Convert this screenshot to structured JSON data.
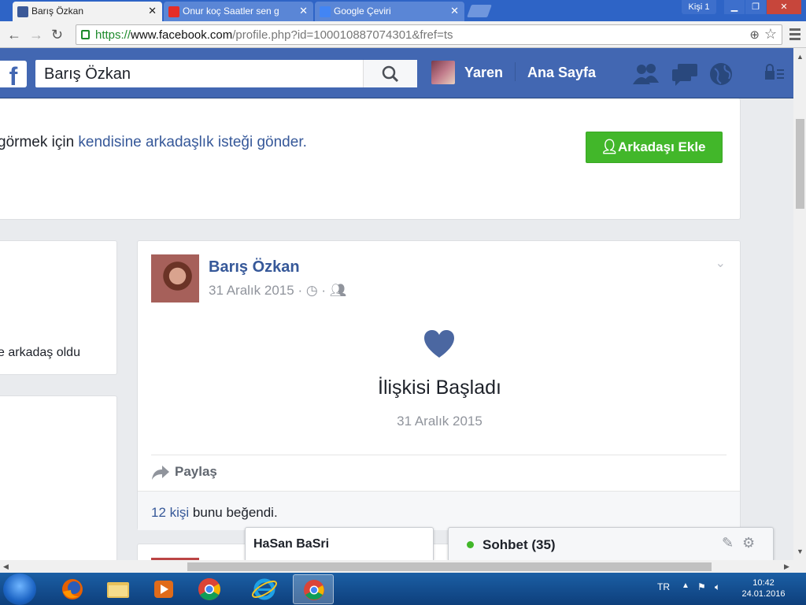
{
  "browser": {
    "tabs": [
      {
        "title": "Barış Özkan",
        "favicon": "facebook-favicon"
      },
      {
        "title": "Onur koç Saatler sen g",
        "favicon": "youtube-favicon"
      },
      {
        "title": "Google Çeviri",
        "favicon": "google-translate-favicon"
      }
    ],
    "profile_label": "Kişi 1",
    "url_scheme": "https://",
    "url_host": "www.facebook.com",
    "url_path": "/profile.php?id=100010887074301&fref=ts"
  },
  "fb_header": {
    "search_value": "Barış Özkan",
    "user_name": "Yaren",
    "home_label": "Ana Sayfa",
    "icons": [
      "friend-requests-icon",
      "messages-icon",
      "notifications-globe-icon",
      "privacy-lock-icon",
      "account-menu-icon"
    ]
  },
  "friend_banner": {
    "text_prefix": "görmek için ",
    "link_text": "kendisine arkadaşlık isteği gönder",
    "text_suffix": ".",
    "add_friend_label": "Arkadaşı Ekle"
  },
  "left_column": {
    "card1_text": "e arkadaş oldu"
  },
  "post": {
    "author": "Barış Özkan",
    "date": "31 Aralık 2015",
    "life_event_title": "İlişkisi Başladı",
    "life_event_date": "31 Aralık 2015",
    "share_label": "Paylaş",
    "likes_link": "12 kişi",
    "likes_suffix": " bunu beğendi.",
    "heart_color": "#4b67a1"
  },
  "chat": {
    "window1_name": "HaSan BaSri",
    "sidebar_title": "Sohbet (35)",
    "online_color": "#42b72a"
  },
  "taskbar": {
    "apps": [
      "windows-explorer",
      "firefox",
      "file-explorer",
      "media-player",
      "chrome",
      "internet-explorer",
      "chrome-active"
    ],
    "language": "TR",
    "time": "10:42",
    "date": "24.01.2016"
  }
}
